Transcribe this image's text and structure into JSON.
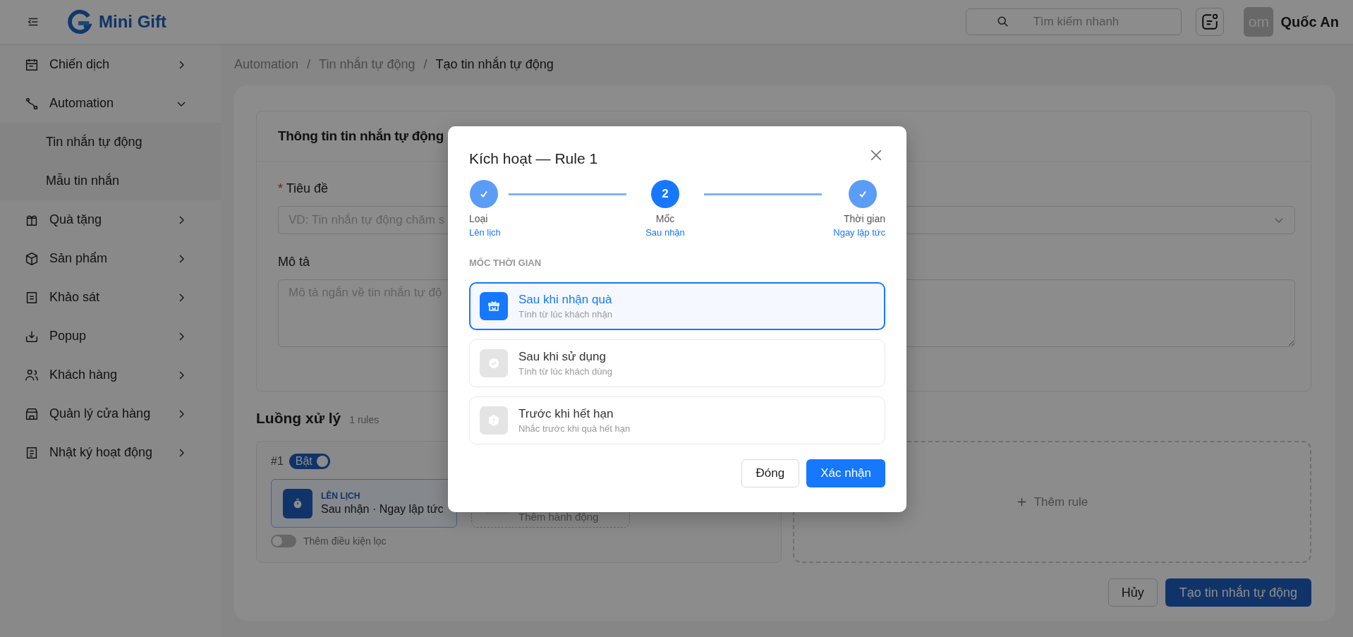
{
  "header": {
    "logo_text": "Mini Gift",
    "search": {
      "placeholder": "Tìm kiếm nhanh"
    },
    "user": {
      "avatar_text": "om",
      "name": "Quốc An"
    }
  },
  "sidebar": {
    "items": [
      {
        "label": "Chiến dịch",
        "expanded": false
      },
      {
        "label": "Automation",
        "expanded": true,
        "children": [
          {
            "label": "Tin nhắn tự động"
          },
          {
            "label": "Mẫu tin nhắn"
          }
        ]
      },
      {
        "label": "Quà tặng",
        "expanded": false
      },
      {
        "label": "Sản phẩm",
        "expanded": false
      },
      {
        "label": "Khảo sát",
        "expanded": false
      },
      {
        "label": "Popup",
        "expanded": false
      },
      {
        "label": "Khách hàng",
        "expanded": false
      },
      {
        "label": "Quản lý cửa hàng",
        "expanded": false
      },
      {
        "label": "Nhật ký hoạt động",
        "expanded": false
      }
    ]
  },
  "breadcrumb": {
    "separator": "/",
    "items": [
      "Automation",
      "Tin nhắn tự động",
      "Tạo tin nhắn tự động"
    ]
  },
  "form": {
    "title": "Thông tin tin nhắn tự động",
    "title_field": {
      "label": "Tiêu đề",
      "required_mark": "*",
      "placeholder": "VD: Tin nhắn tự động chăm s"
    },
    "description_field": {
      "label": "Mô tả",
      "placeholder": "Mô tả ngắn về tin nhắn tự độ"
    }
  },
  "flow": {
    "title": "Luồng xử lý",
    "count": "1 rules",
    "rules": [
      {
        "number": "#1",
        "enabled": true,
        "toggle_label": "Bật",
        "trigger": {
          "type": "LÊN LỊCH",
          "summary": "Sau nhận · Ngay lập tức"
        },
        "action_placeholder": "Thêm hành động",
        "filter": {
          "on": false,
          "label": "Thêm điều kiện lọc"
        }
      }
    ],
    "add_rule": "Thêm rule"
  },
  "actions": {
    "cancel": "Hủy",
    "submit": "Tạo tin nhắn tự động"
  },
  "modal": {
    "title": "Kích hoạt — Rule 1",
    "steps": [
      {
        "label": "Loại",
        "value": "Lên lịch",
        "completed": true
      },
      {
        "label": "Mốc",
        "value": "Sau nhận",
        "completed": false,
        "number": "2"
      },
      {
        "label": "Thời gian",
        "value": "Ngay lập tức",
        "completed": true
      }
    ],
    "section_label": "MỐC THỜI GIAN",
    "options": [
      {
        "title": "Sau khi nhận quà",
        "subtitle": "Tính từ lúc khách nhận",
        "selected": true
      },
      {
        "title": "Sau khi sử dụng",
        "subtitle": "Tính từ lúc khách dùng",
        "selected": false
      },
      {
        "title": "Trước khi hết hạn",
        "subtitle": "Nhắc trước khi quà hết hạn",
        "selected": false
      }
    ],
    "close_button": "Đóng",
    "confirm_button": "Xác nhận"
  }
}
